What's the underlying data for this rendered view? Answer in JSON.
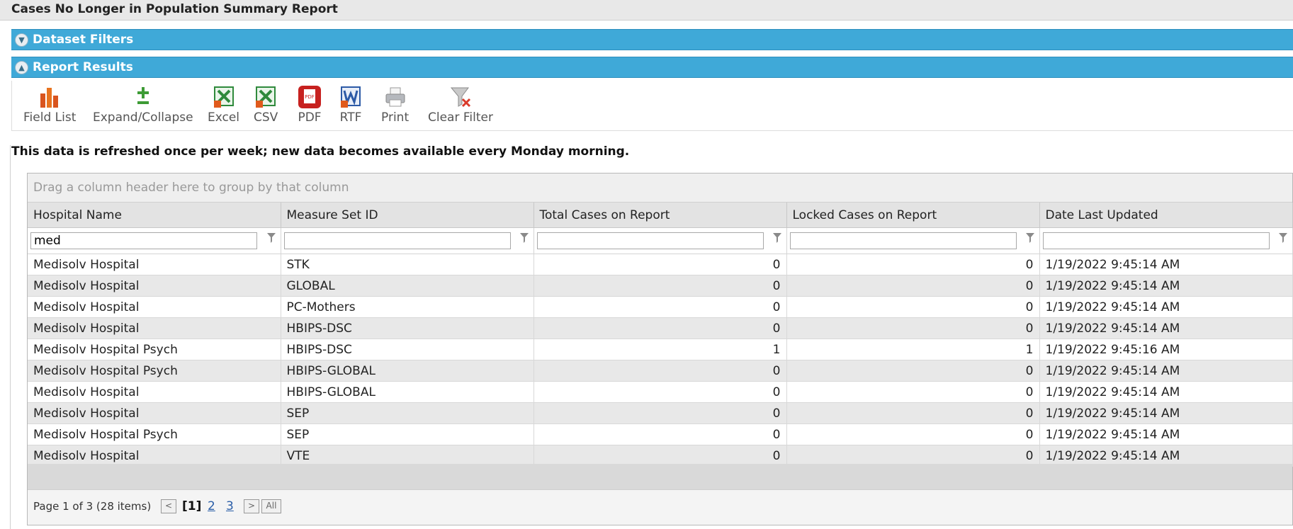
{
  "window": {
    "title": "Cases No Longer in Population Summary Report"
  },
  "panels": {
    "dataset_filters": "Dataset Filters",
    "report_results": "Report Results"
  },
  "toolbar": {
    "field_list": "Field List",
    "expand_collapse": "Expand/Collapse",
    "excel": "Excel",
    "csv": "CSV",
    "pdf": "PDF",
    "rtf": "RTF",
    "print": "Print",
    "clear_filter": "Clear Filter"
  },
  "notice": "This data is refreshed once per week; new data becomes available every Monday morning.",
  "grid": {
    "group_panel_text": "Drag a column header here to group by that column",
    "columns": [
      "Hospital Name",
      "Measure Set ID",
      "Total Cases on Report",
      "Locked Cases on Report",
      "Date Last Updated"
    ],
    "filters": [
      "med",
      "",
      "",
      "",
      ""
    ],
    "rows": [
      [
        "Medisolv Hospital",
        "STK",
        "0",
        "0",
        "1/19/2022 9:45:14 AM"
      ],
      [
        "Medisolv Hospital",
        "GLOBAL",
        "0",
        "0",
        "1/19/2022 9:45:14 AM"
      ],
      [
        "Medisolv Hospital",
        "PC-Mothers",
        "0",
        "0",
        "1/19/2022 9:45:14 AM"
      ],
      [
        "Medisolv Hospital",
        "HBIPS-DSC",
        "0",
        "0",
        "1/19/2022 9:45:14 AM"
      ],
      [
        "Medisolv Hospital Psych",
        "HBIPS-DSC",
        "1",
        "1",
        "1/19/2022 9:45:16 AM"
      ],
      [
        "Medisolv Hospital Psych",
        "HBIPS-GLOBAL",
        "0",
        "0",
        "1/19/2022 9:45:14 AM"
      ],
      [
        "Medisolv Hospital",
        "HBIPS-GLOBAL",
        "0",
        "0",
        "1/19/2022 9:45:14 AM"
      ],
      [
        "Medisolv Hospital",
        "SEP",
        "0",
        "0",
        "1/19/2022 9:45:14 AM"
      ],
      [
        "Medisolv Hospital Psych",
        "SEP",
        "0",
        "0",
        "1/19/2022 9:45:14 AM"
      ],
      [
        "Medisolv Hospital",
        "VTE",
        "0",
        "0",
        "1/19/2022 9:45:14 AM"
      ]
    ]
  },
  "pager": {
    "info": "Page 1 of 3 (28 items)",
    "prev": "<",
    "pages": [
      "[1]",
      "2",
      "3"
    ],
    "next": ">",
    "all": "All"
  }
}
